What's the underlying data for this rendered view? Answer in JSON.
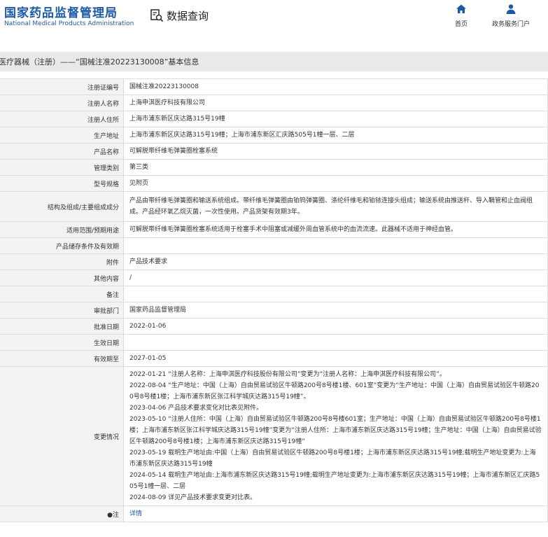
{
  "header": {
    "logo_cn": "国家药品监督管理局",
    "logo_en": "National Medical Products Administration",
    "query_label": "数据查询",
    "nav": [
      {
        "label": "首页",
        "icon": "home-icon"
      },
      {
        "label": "政务服务门户",
        "icon": "user-icon"
      }
    ]
  },
  "page_title": "医疗器械（注册）——“国械注准20223130008”基本信息",
  "rows": [
    {
      "label": "注册证编号",
      "value": "国械注准20223130008"
    },
    {
      "label": "注册人名称",
      "value": "上海申淇医疗科技有限公司"
    },
    {
      "label": "注册人住所",
      "value": "上海市浦东新区庆达路315号19幢"
    },
    {
      "label": "生产地址",
      "value": "上海市浦东新区庆达路315号19幢；上海市浦东新区汇庆路505号1幢一层、二层"
    },
    {
      "label": "产品名称",
      "value": "可解脱带纤维毛弹簧圈栓塞系统"
    },
    {
      "label": "管理类别",
      "value": "第三类"
    },
    {
      "label": "型号规格",
      "value": "见附页"
    },
    {
      "label": "结构及组成/主要组成成分",
      "value": "产品由带纤维毛弹簧圈和输送系统组成。带纤维毛弹簧圈由铂钨弹簧圈、涤纶纤维毛和铂铱连接头组成；输送系统由推送杆、导入鞘管和止血阀组成。产品经环氧乙烷灭菌，一次性使用。产品货架有效期3年。"
    },
    {
      "label": "适用范围/预期用途",
      "value": "可解脱带纤维毛弹簧圈栓塞系统适用于栓塞手术中阻塞或减缓外周血管系统中的血流流速。此器械不适用于神经血管。"
    },
    {
      "label": "产品储存条件及有效期",
      "value": ""
    },
    {
      "label": "附件",
      "value": "产品技术要求"
    },
    {
      "label": "其他内容",
      "value": "/"
    },
    {
      "label": "备注",
      "value": ""
    },
    {
      "label": "审批部门",
      "value": "国家药品监督管理局"
    },
    {
      "label": "批准日期",
      "value": "2022-01-06"
    },
    {
      "label": "生效日期",
      "value": ""
    },
    {
      "label": "有效期至",
      "value": "2027-01-05"
    }
  ],
  "changes": {
    "label": "变更情况",
    "entries": [
      "2022-01-21 “注册人名称：上海申淇医疗科技股份有限公司”变更为“注册人名称：上海申淇医疗科技有限公司”。",
      "2022-08-04 “生产地址：中国（上海）自由贸易试验区牛顿路200号8号楼1楼、601室”变更为“生产地址：中国（上海）自由贸易试验区牛顿路200号8号楼1楼；上海市浦东新区张江科学城庆达路315号19幢”。",
      "2023-04-06 产品技术要求变化对比表见附件。",
      "2023-05-10 “注册人住所：中国（上海）自由贸易试验区牛顿路200号8号楼601室；生产地址：中国（上海）自由贸易试验区牛顿路200号8号楼1楼；上海市浦东新区张江科学城庆达路315号19幢”变更为“注册人住所：上海市浦东新区庆达路315号19幢；生产地址：中国（上海）自由贸易试验区牛顿路200号8号楼1楼；上海市浦东新区庆达路315号19幢”",
      "2023-05-19 载明生产地址由:中国（上海）自由贸易试验区牛顿路200号8号楼1楼；上海市浦东新区庆达路315号19幢;载明生产地址变更为:上海市浦东新区庆达路315号19幢",
      "2024-05-14 载明生产地址由:上海市浦东新区庆达路315号19幢;载明生产地址变更为:上海市浦东新区庆达路315号19幢；上海市浦东新区汇庆路505号1幢一层、二层",
      "2024-08-09 详见产品技术要求变更对比表。"
    ]
  },
  "note": {
    "label": "●注",
    "link": "详情"
  }
}
